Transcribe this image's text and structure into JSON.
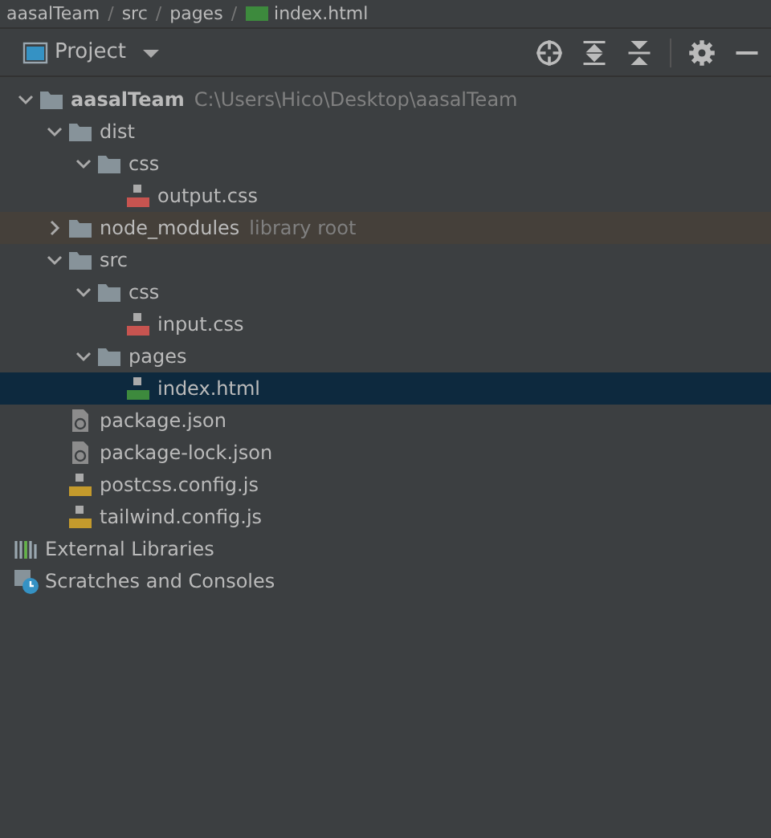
{
  "breadcrumb": [
    {
      "kind": "item",
      "text": "aasalTeam"
    },
    {
      "kind": "separator",
      "text": "/"
    },
    {
      "kind": "item",
      "text": "src"
    },
    {
      "kind": "separator",
      "text": "/"
    },
    {
      "kind": "item",
      "text": "pages"
    },
    {
      "kind": "separator",
      "text": "/"
    },
    {
      "kind": "file",
      "text": "index.html"
    }
  ],
  "panel": {
    "title": "Project"
  },
  "tree": [
    {
      "label": "aasalTeam",
      "kind": "root",
      "note": "C:\\Users\\Hico\\Desktop\\aasalTeam",
      "expanded": true,
      "selected": false,
      "children": [
        {
          "label": "dist",
          "kind": "folder",
          "expanded": true,
          "selected": false,
          "children": [
            {
              "label": "css",
              "kind": "folder",
              "expanded": true,
              "selected": false,
              "children": [
                {
                  "label": "output.css",
                  "kind": "css",
                  "selected": false
                }
              ]
            }
          ]
        },
        {
          "label": "node_modules",
          "kind": "folder",
          "note": "library root",
          "highlighted": true,
          "expanded": false,
          "selected": false
        },
        {
          "label": "src",
          "kind": "folder",
          "expanded": true,
          "selected": false,
          "children": [
            {
              "label": "css",
              "kind": "folder",
              "expanded": true,
              "selected": false,
              "children": [
                {
                  "label": "input.css",
                  "kind": "css",
                  "selected": false
                }
              ]
            },
            {
              "label": "pages",
              "kind": "folder",
              "expanded": true,
              "selected": false,
              "children": [
                {
                  "label": "index.html",
                  "kind": "html",
                  "selected": true
                }
              ]
            }
          ]
        },
        {
          "label": "package.json",
          "kind": "json",
          "selected": false
        },
        {
          "label": "package-lock.json",
          "kind": "json",
          "selected": false
        },
        {
          "label": "postcss.config.js",
          "kind": "js",
          "selected": false
        },
        {
          "label": "tailwind.config.js",
          "kind": "js",
          "selected": false
        }
      ]
    },
    {
      "label": "External Libraries",
      "kind": "libraries",
      "selected": false
    },
    {
      "label": "Scratches and Consoles",
      "kind": "scratches",
      "selected": false
    }
  ]
}
